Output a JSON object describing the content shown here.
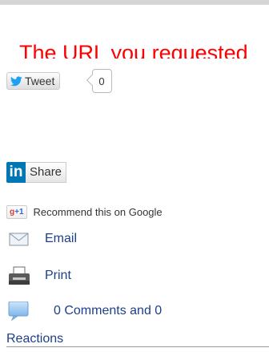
{
  "headline": "The URL you requested",
  "twitter": {
    "button_label": "Tweet",
    "count": "0"
  },
  "linkedin": {
    "icon_text": "in",
    "label": "Share"
  },
  "google": {
    "button_g": "g",
    "button_plus": "+1",
    "label": "Recommend this on Google"
  },
  "actions": {
    "email": "Email",
    "print": "Print",
    "comments": "0 Comments and 0",
    "reactions": "Reactions"
  },
  "colors": {
    "headline": "#ff0000",
    "link": "#1d3f89",
    "linkedin": "#0077b5",
    "twitter": "#1da1f2"
  }
}
